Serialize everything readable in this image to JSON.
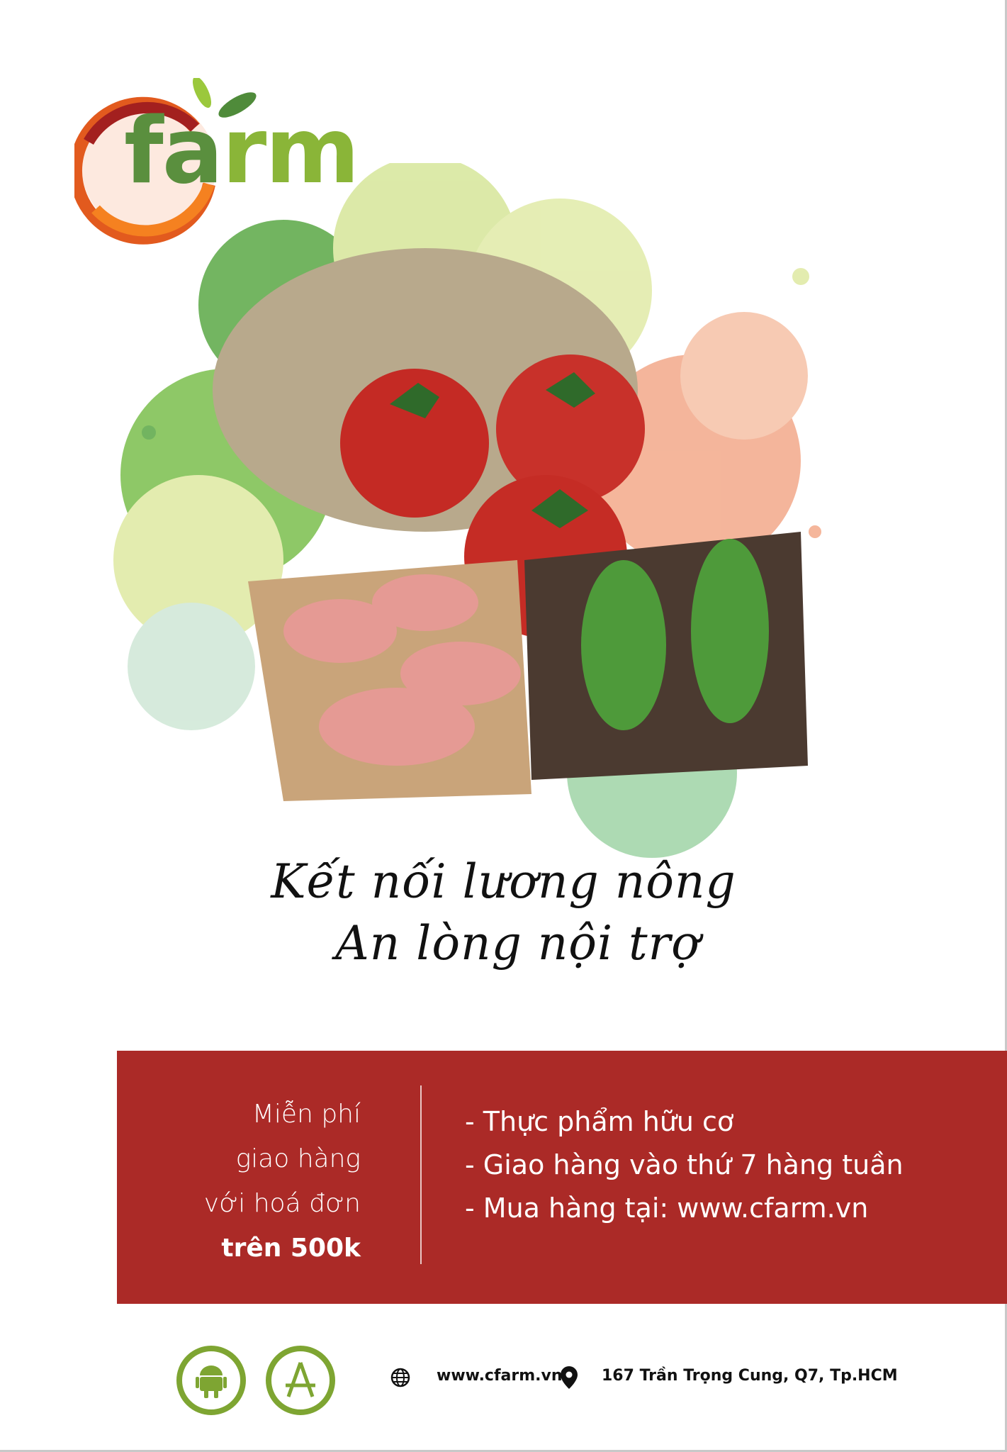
{
  "logo": {
    "text": "farm",
    "full_name": "cfarm"
  },
  "tagline": {
    "line1": "Kết nối lương nông",
    "line2": "An lòng nội trợ"
  },
  "promo": {
    "left_lines": [
      "Miễn phí",
      "giao hàng",
      "với hoá đơn"
    ],
    "left_bold": "trên 500k",
    "bullets": [
      "- Thực phẩm hữu cơ",
      "- Giao hàng vào thứ 7 hàng tuần",
      "- Mua hàng tại: www.cfarm.vn"
    ]
  },
  "footer": {
    "apps": [
      {
        "icon": "android-icon"
      },
      {
        "icon": "app-store-icon"
      }
    ],
    "website": "www.cfarm.vn",
    "address": "167 Trần Trọng Cung, Q7, Tp.HCM"
  },
  "colors": {
    "red": "#ab2a27",
    "green": "#7ea532",
    "dark_green": "#4f8b3a",
    "orange": "#f07a22"
  }
}
